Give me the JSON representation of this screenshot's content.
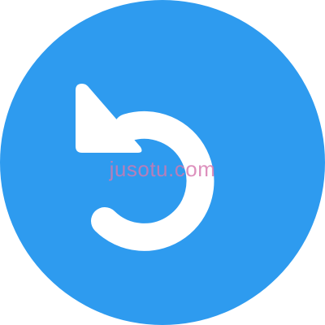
{
  "icon": {
    "name": "undo-icon",
    "background_color": "#2e9bef",
    "glyph_color": "#ffffff"
  },
  "watermark": {
    "text": "jusotu.com",
    "color": "#d678af"
  }
}
